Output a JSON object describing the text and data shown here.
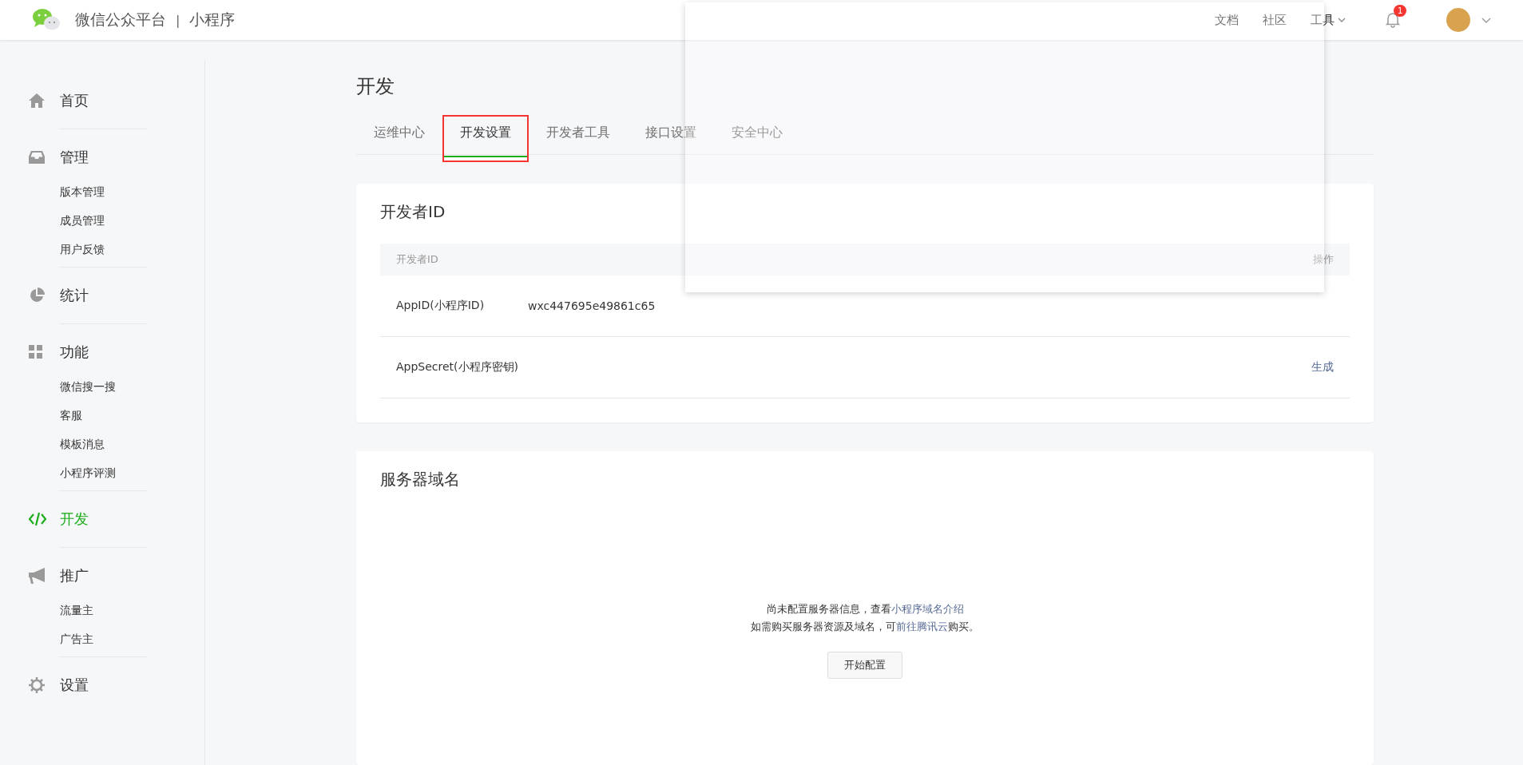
{
  "header": {
    "brand": "微信公众平台",
    "separator": "|",
    "product": "小程序",
    "nav": [
      {
        "label": "文档",
        "dropdown": false
      },
      {
        "label": "社区",
        "dropdown": false
      },
      {
        "label": "工具",
        "dropdown": true
      }
    ],
    "notification_count": "1"
  },
  "sidebar": {
    "sections": [
      {
        "label": "首页",
        "selected": false
      },
      {
        "label": "管理",
        "selected": false,
        "children": [
          {
            "label": "版本管理"
          },
          {
            "label": "成员管理"
          },
          {
            "label": "用户反馈"
          }
        ]
      },
      {
        "label": "统计",
        "selected": false
      },
      {
        "label": "功能",
        "selected": false,
        "children": [
          {
            "label": "微信搜一搜"
          },
          {
            "label": "客服"
          },
          {
            "label": "模板消息"
          },
          {
            "label": "小程序评测"
          }
        ]
      },
      {
        "label": "开发",
        "selected": true
      },
      {
        "label": "推广",
        "selected": false,
        "children": [
          {
            "label": "流量主"
          },
          {
            "label": "广告主"
          }
        ]
      },
      {
        "label": "设置",
        "selected": false
      }
    ]
  },
  "page_title": "开发",
  "tabs": [
    {
      "label": "运维中心",
      "selected": false
    },
    {
      "label": "开发设置",
      "selected": true
    },
    {
      "label": "开发者工具",
      "selected": false
    },
    {
      "label": "接口设置",
      "selected": false
    },
    {
      "label": "安全中心",
      "selected": false
    }
  ],
  "developer_id": {
    "title": "开发者ID",
    "columns": [
      "开发者ID",
      "操作"
    ],
    "rows": [
      {
        "label": "AppID(小程序ID)",
        "value": "wxc447695e49861c65"
      },
      {
        "label": "AppSecret(小程序密钥)",
        "action": "生成"
      }
    ]
  },
  "server_domain": {
    "title": "服务器域名",
    "message": [
      {
        "before": "尚未配置服务器信息，查看",
        "link": "小程序域名介绍"
      },
      {
        "before": "如需购买服务器资源及域名，可",
        "link": "前往腾讯云",
        "after": "购买。"
      }
    ],
    "button": "开始配置"
  }
}
